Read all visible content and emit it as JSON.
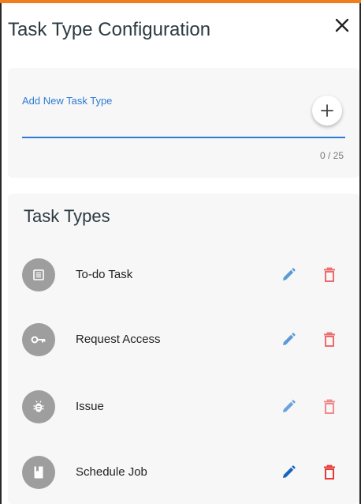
{
  "dialog": {
    "title": "Task Type Configuration",
    "close_icon": "close-icon"
  },
  "add_new": {
    "label": "Add New Task Type",
    "value": "",
    "counter": "0 / 25",
    "add_icon": "plus-icon"
  },
  "task_types": {
    "heading": "Task Types",
    "items": [
      {
        "label": "To-do Task",
        "icon": "list-icon",
        "edit_color": "#5b9bd5",
        "delete_color": "#ef6b6b"
      },
      {
        "label": "Request Access",
        "icon": "key-icon",
        "edit_color": "#5b9bd5",
        "delete_color": "#ef6b6b"
      },
      {
        "label": "Issue",
        "icon": "bug-icon",
        "edit_color": "#6ba2d9",
        "delete_color": "#f08a8a"
      },
      {
        "label": "Schedule Job",
        "icon": "book-icon",
        "edit_color": "#1565c0",
        "delete_color": "#e53935"
      }
    ]
  },
  "colors": {
    "accent": "#f07d1e",
    "primary": "#2f7bd5",
    "avatar": "#9e9e9e",
    "panel": "#f7f7f7"
  }
}
